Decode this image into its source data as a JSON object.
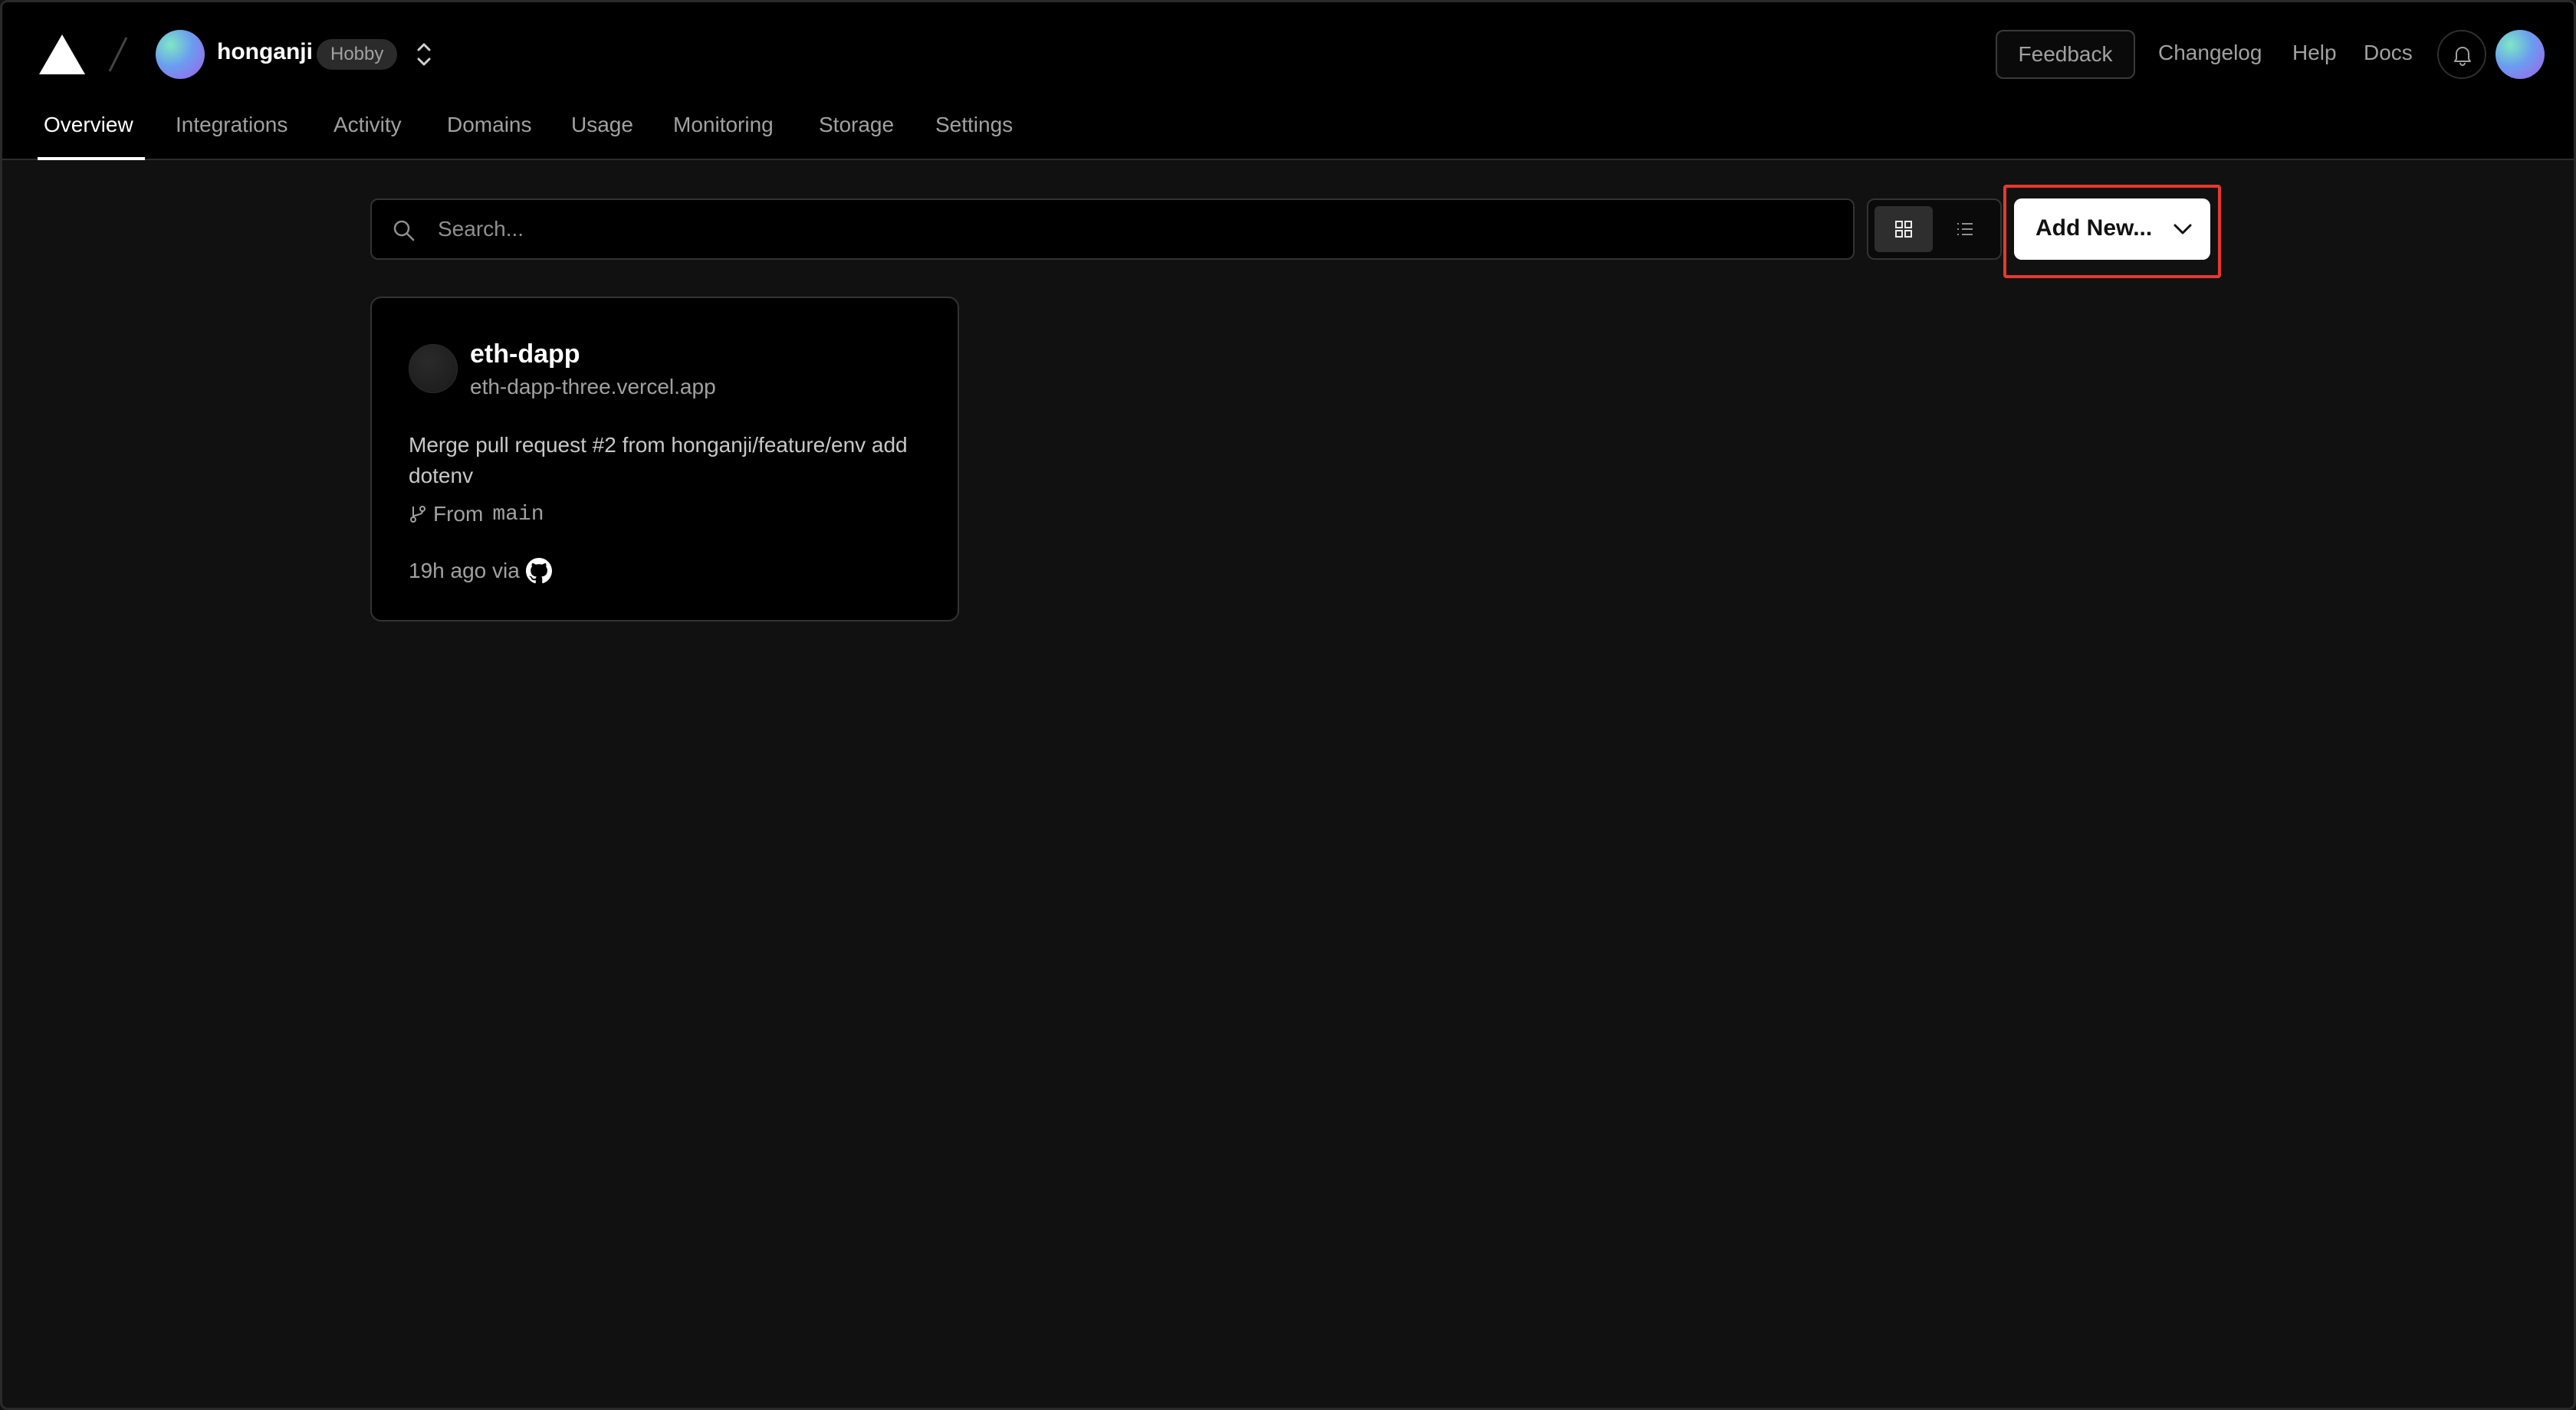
{
  "header": {
    "team_name": "honganji",
    "plan_badge": "Hobby",
    "feedback_label": "Feedback",
    "links": {
      "changelog": "Changelog",
      "help": "Help",
      "docs": "Docs"
    }
  },
  "nav": {
    "tabs": [
      {
        "label": "Overview",
        "active": true
      },
      {
        "label": "Integrations"
      },
      {
        "label": "Activity"
      },
      {
        "label": "Domains"
      },
      {
        "label": "Usage"
      },
      {
        "label": "Monitoring"
      },
      {
        "label": "Storage"
      },
      {
        "label": "Settings"
      }
    ]
  },
  "toolbar": {
    "search_placeholder": "Search...",
    "add_new_label": "Add New...",
    "view_mode": "grid"
  },
  "projects": [
    {
      "name": "eth-dapp",
      "url": "eth-dapp-three.vercel.app",
      "commit_message": "Merge pull request #2 from honganji/feature/env add dotenv",
      "branch_prefix": "From",
      "branch": "main",
      "updated": "19h ago via"
    }
  ],
  "colors": {
    "background": "#111111",
    "header_bg": "#000000",
    "highlight": "#e5392e",
    "text_primary": "#ffffff",
    "text_secondary": "#a1a1a1"
  }
}
